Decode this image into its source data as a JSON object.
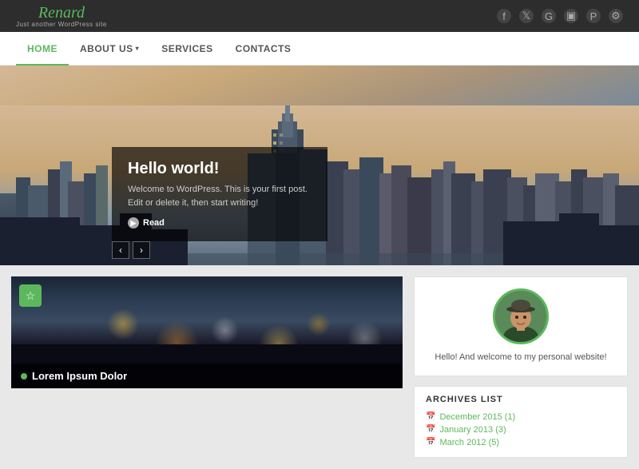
{
  "header": {
    "logo": "Renard",
    "logo_subtitle": "Just another WordPress site",
    "social_icons": [
      "f",
      "t",
      "g+",
      "📷",
      "p",
      "⚙"
    ]
  },
  "nav": {
    "items": [
      {
        "label": "HOME",
        "active": true
      },
      {
        "label": "ABOUT US",
        "has_dropdown": true
      },
      {
        "label": "SERVICES",
        "has_dropdown": false
      },
      {
        "label": "CONTACTS",
        "has_dropdown": false
      }
    ]
  },
  "hero": {
    "title": "Hello world!",
    "description": "Welcome to WordPress. This is your first post. Edit or delete it, then start writing!",
    "read_label": "Read",
    "prev_label": "‹",
    "next_label": "›"
  },
  "post": {
    "title": "Lorem Ipsum Dolor",
    "star_icon": "☆"
  },
  "profile_widget": {
    "text": "Hello! And welcome to my personal website!"
  },
  "archives": {
    "title": "ARCHIVES LIST",
    "items": [
      "December 2015 (1)",
      "January 2013 (3)",
      "March 2012 (5)"
    ]
  }
}
